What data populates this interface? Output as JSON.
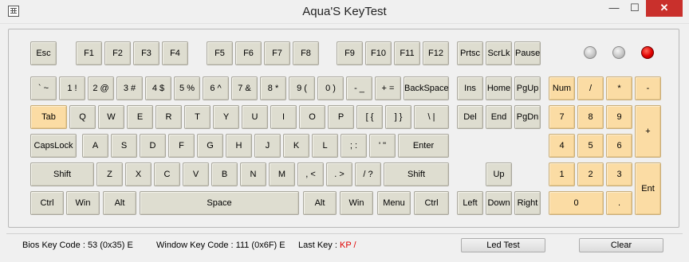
{
  "window": {
    "title": "Aqua'S KeyTest",
    "min_glyph": "—",
    "max_glyph": "☐",
    "close_glyph": "✕"
  },
  "keyboard": {
    "main": {
      "esc": "Esc",
      "f1": "F1",
      "f2": "F2",
      "f3": "F3",
      "f4": "F4",
      "f5": "F5",
      "f6": "F6",
      "f7": "F7",
      "f8": "F8",
      "f9": "F9",
      "f10": "F10",
      "f11": "F11",
      "f12": "F12",
      "backtick": "` ~",
      "d1": "1 !",
      "d2": "2 @",
      "d3": "3 #",
      "d4": "4 $",
      "d5": "5 %",
      "d6": "6 ^",
      "d7": "7 &",
      "d8": "8 *",
      "d9": "9 (",
      "d0": "0 )",
      "minus": "- _",
      "equal": "+ =",
      "backspace": "BackSpace",
      "tab": "Tab",
      "q": "Q",
      "w": "W",
      "e": "E",
      "r": "R",
      "t": "T",
      "y": "Y",
      "u": "U",
      "i": "I",
      "o": "O",
      "p": "P",
      "lbracket": "[ {",
      "rbracket": "] }",
      "backslash": "\\ |",
      "capslock": "CapsLock",
      "a": "A",
      "s": "S",
      "d": "D",
      "f": "F",
      "g": "G",
      "h": "H",
      "j": "J",
      "k": "K",
      "l": "L",
      "semicolon": "; :",
      "quote": "' \"",
      "enter": "Enter",
      "lshift": "Shift",
      "z": "Z",
      "x": "X",
      "c": "C",
      "v": "V",
      "b": "B",
      "n": "N",
      "m": "M",
      "comma": ", <",
      "period": ". >",
      "slash": "/ ?",
      "rshift": "Shift",
      "lctrl": "Ctrl",
      "lwin": "Win",
      "lalt": "Alt",
      "space": "Space",
      "ralt": "Alt",
      "rwin": "Win",
      "menu": "Menu",
      "rctrl": "Ctrl"
    },
    "nav": {
      "prtsc": "Prtsc",
      "scrlk": "ScrLk",
      "pause": "Pause",
      "ins": "Ins",
      "home": "Home",
      "pgup": "PgUp",
      "del": "Del",
      "end": "End",
      "pgdn": "PgDn",
      "up": "Up",
      "left": "Left",
      "down": "Down",
      "right": "Right"
    },
    "numpad": {
      "numlock": "Num",
      "divide": "/",
      "multiply": "*",
      "subtract": "-",
      "n7": "7",
      "n8": "8",
      "n9": "9",
      "add": "+",
      "n4": "4",
      "n5": "5",
      "n6": "6",
      "n1": "1",
      "n2": "2",
      "n3": "3",
      "enter": "Ent",
      "n0": "0",
      "decimal": "."
    },
    "active_key": "Tab",
    "leds": [
      {
        "name": "num-lock",
        "on": false
      },
      {
        "name": "caps-lock",
        "on": false
      },
      {
        "name": "scroll-lock",
        "on": true
      }
    ]
  },
  "status": {
    "bios_label": "Bios Key Code : ",
    "bios_value": "53 (0x35) E",
    "window_label": "Window Key Code : ",
    "window_value": "111 (0x6F) E",
    "last_label": "Last Key : ",
    "last_value": "KP /",
    "last_color": "#e00000",
    "led_test_label": "Led Test",
    "clear_label": "Clear"
  }
}
